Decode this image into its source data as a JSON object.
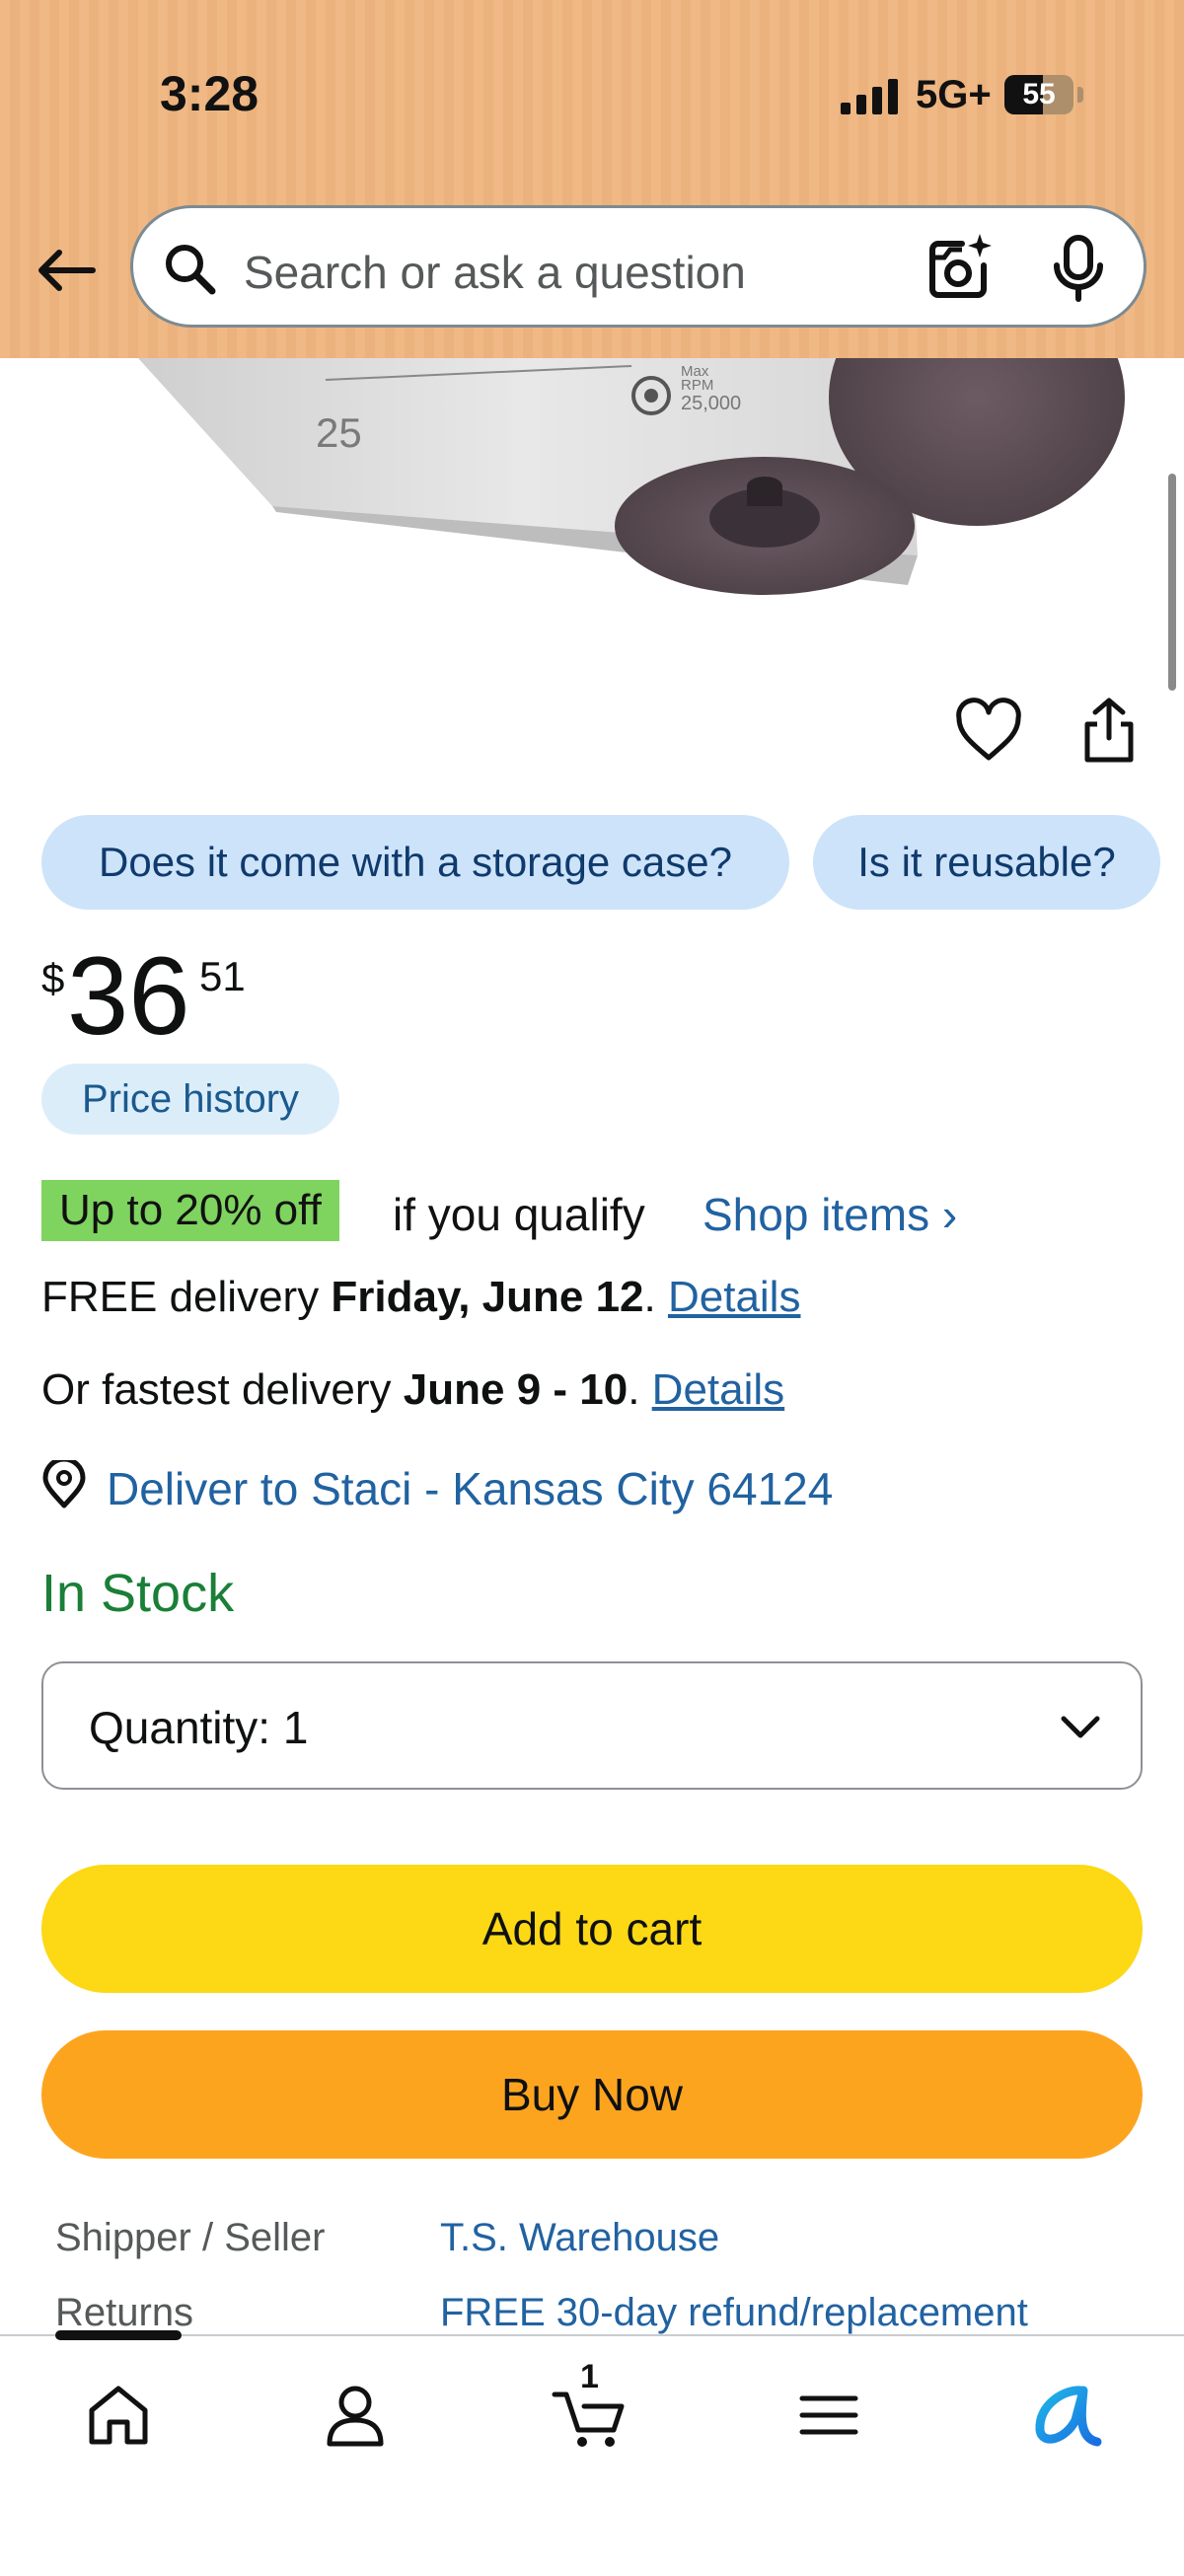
{
  "status_bar": {
    "time": "3:28",
    "network": "5G+",
    "battery": "55",
    "battery_level": 0.55
  },
  "header": {
    "search_placeholder": "Search or ask a question",
    "icons": [
      "back-arrow-icon",
      "search-icon",
      "camera-search-icon",
      "microphone-icon"
    ],
    "background_color": "#efb884"
  },
  "product_image": {
    "box_number": "25",
    "box_label_1": "Max",
    "box_label_2": "RPM",
    "box_label_3": "25,000"
  },
  "questions": [
    "Does it come with a storage case?",
    "Is it reusable?"
  ],
  "price": {
    "symbol": "$",
    "whole": "36",
    "fraction": "51",
    "history_label": "Price history"
  },
  "deal": {
    "badge": "Up to 20% off",
    "text": "if you qualify",
    "link": "Shop items ›",
    "badge_color": "#7fd35f"
  },
  "delivery": {
    "free_prefix": "FREE delivery ",
    "free_date": "Friday, June 12",
    "fast_prefix": "Or fastest delivery ",
    "fast_date": "June 9 - 10",
    "details_label": "Details",
    "location": "Deliver to Staci - Kansas City 64124"
  },
  "stock": {
    "status": "In Stock",
    "color": "#1a7f37"
  },
  "quantity": {
    "label": "Quantity:",
    "value": "1"
  },
  "buttons": {
    "add_to_cart": "Add to cart",
    "buy_now": "Buy Now",
    "add_color": "#fcd815",
    "buy_color": "#fda41f"
  },
  "info": [
    {
      "label": "Shipper / Seller",
      "value": "T.S. Warehouse"
    },
    {
      "label": "Returns",
      "value": "FREE 30-day refund/replacement"
    }
  ],
  "bottom_nav": {
    "items": [
      "home-icon",
      "account-icon",
      "cart-icon",
      "menu-icon",
      "rufus-icon"
    ],
    "cart_count": "1"
  }
}
